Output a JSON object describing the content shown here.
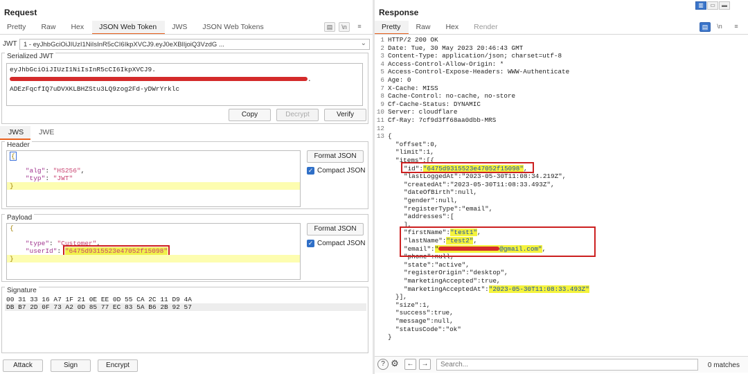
{
  "request": {
    "title": "Request",
    "tabs": [
      {
        "label": "Pretty"
      },
      {
        "label": "Raw"
      },
      {
        "label": "Hex"
      },
      {
        "label": "JSON Web Token"
      },
      {
        "label": "JWS"
      },
      {
        "label": "JSON Web Tokens"
      }
    ],
    "jwt_label": "JWT",
    "jwt_selected": "1 - eyJhbGciOiJIUzI1NiIsInR5cCI6IkpXVCJ9.eyJ0eXBlIjoiQ3VzdG ...",
    "serialized": {
      "legend": "Serialized JWT",
      "line1": "eyJhbGciOiJIUzI1NiIsInR5cCI6IkpXVCJ9.",
      "line3": "ADEzFqcfIQ7uDVXKLBHZStu3LQ9zog2Fd-yDWrYrklc",
      "copy": "Copy",
      "decrypt": "Decrypt",
      "verify": "Verify"
    },
    "jws_tabs": [
      {
        "label": "JWS"
      },
      {
        "label": "JWE"
      }
    ],
    "header": {
      "legend": "Header",
      "open": "{",
      "alg_key": "\"alg\"",
      "alg_val": "\"HS256\"",
      "typ_key": "\"typ\"",
      "typ_val": "\"JWT\"",
      "close": "}"
    },
    "payload": {
      "legend": "Payload",
      "open": "{",
      "type_key": "\"type\"",
      "type_val": "\"Customer\"",
      "user_key": "\"userId\"",
      "user_val": "\"6475d9315523e47052f15098\"",
      "close": "}"
    },
    "format_json": "Format JSON",
    "compact_json": "Compact JSON",
    "signature": {
      "legend": "Signature",
      "row1": "00 31 33 16 A7 1F 21 0E EE 0D 55 CA 2C 11 D9 4A",
      "row2": "DB B7 2D 0F 73 A2 0D 85 77 EC 83 5A B6 2B 92 57"
    },
    "buttons": {
      "attack": "Attack",
      "sign": "Sign",
      "encrypt": "Encrypt"
    }
  },
  "response": {
    "title": "Response",
    "tabs": [
      {
        "label": "Pretty"
      },
      {
        "label": "Raw"
      },
      {
        "label": "Hex"
      },
      {
        "label": "Render"
      }
    ],
    "headers": [
      "HTTP/2 200 OK",
      "Date: Tue, 30 May 2023 20:46:43 GMT",
      "Content-Type: application/json; charset=utf-8",
      "Access-Control-Allow-Origin: *",
      "Access-Control-Expose-Headers: WWW-Authenticate",
      "Age: 0",
      "X-Cache: MISS",
      "Cache-Control: no-cache, no-store",
      "Cf-Cache-Status: DYNAMIC",
      "Server: cloudflare",
      "Cf-Ray: 7cf9d3ff68aa0dbb-MRS"
    ],
    "body": {
      "open": "{",
      "offset": "\"offset\":0,",
      "limit": "\"limit\":1,",
      "items_open": "\"items\":[{",
      "id_key": "\"id\":",
      "id_val": "\"6475d9315523e47052f15098\"",
      "lastLoggedAt": "\"lastLoggedAt\":\"2023-05-30T11:08:34.219Z\",",
      "createdAt": "\"createdAt\":\"2023-05-30T11:08:33.493Z\",",
      "dateOfBirth": "\"dateOfBirth\":null,",
      "gender": "\"gender\":null,",
      "registerType": "\"registerType\":\"email\",",
      "addresses": "\"addresses\":[",
      "addresses_close": "],",
      "firstName_key": "\"firstName\":",
      "firstName_val": "\"test1\"",
      "lastName_key": "\"lastName\":",
      "lastName_val": "\"test2\"",
      "email_key": "\"email\":",
      "email_val": "@gmail.com\"",
      "phone": "\"phone\":null,",
      "state": "\"state\":\"active\",",
      "registerOrigin": "\"registerOrigin\":\"desktop\",",
      "marketingAccepted": "\"marketingAccepted\":true,",
      "marketingAcceptedAt_key": "\"marketingAcceptedAt\":",
      "marketingAcceptedAt_val": "\"2023-05-30T11:08:33.493Z\"",
      "items_close": "}],",
      "size": "\"size\":1,",
      "success": "\"success\":true,",
      "message": "\"message\":null,",
      "statusCode": "\"statusCode\":\"ok\"",
      "close": "}"
    },
    "search_placeholder": "Search...",
    "matches": "0 matches"
  },
  "colors": {
    "accent": "#e8601c",
    "highlight": "#f4f33c",
    "annotation": "#cc1f1f",
    "checkbox": "#2f6fc7"
  }
}
